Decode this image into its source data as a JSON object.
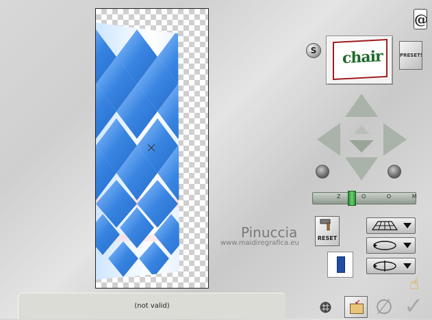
{
  "logo_icon": "@",
  "s_button_label": "S",
  "preset_thumbnail_word": "chair",
  "presets_label": "PRESETS",
  "zoom_slider_ticks": "Z O O M",
  "zoom_level": 0.38,
  "watermark": {
    "title": "Pinuccia",
    "url": "www.maidiregrafica.eu"
  },
  "reset_label": "RESET",
  "status_text": "(not valid)",
  "icons": {
    "logo": "logo-icon",
    "hand": "hand-icon",
    "grid": "grid-icon",
    "open": "open-folder-icon",
    "cancel": "cancel-icon",
    "ok": "checkmark-icon",
    "perspective": "perspective-grid-icon",
    "rotate": "rotate-ellipse-icon",
    "flip": "flip-ellipse-icon",
    "device": "blue-bar-icon"
  },
  "colors": {
    "preview_blue": "#2f7fe0",
    "preview_light": "#d9ecff",
    "preview_pink": "#ffd5d8",
    "arrow_green_gray": "#a9b3a9",
    "zoom_thumb": "#3aa842"
  }
}
